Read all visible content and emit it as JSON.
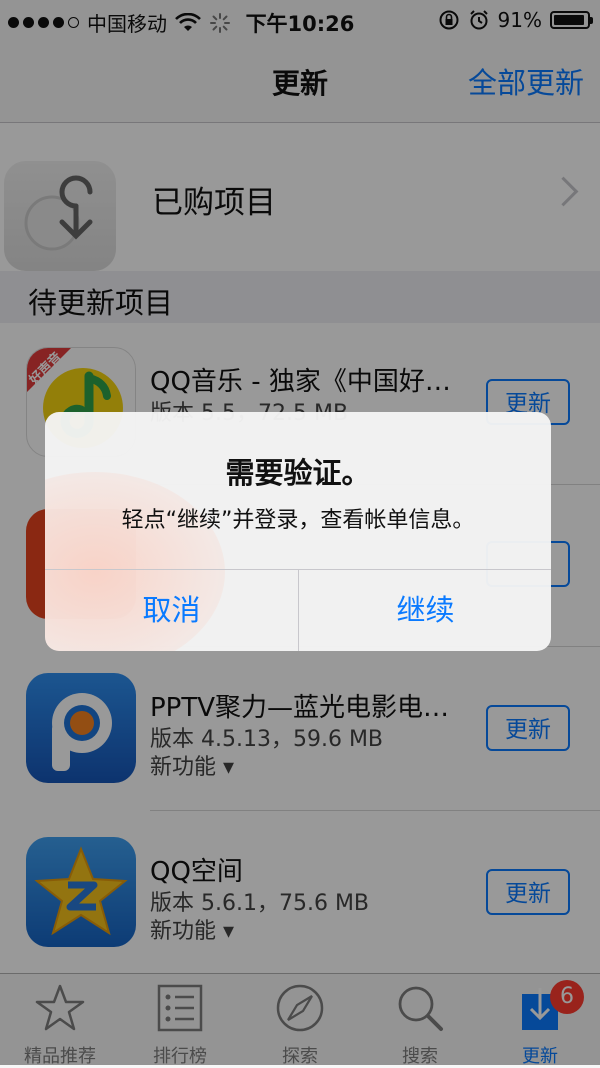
{
  "status_bar": {
    "carrier": "中国移动",
    "time": "下午10:26",
    "battery_percent": "91%",
    "battery_level": 0.91,
    "signal_bars_filled": 4,
    "signal_bars_total": 5
  },
  "nav": {
    "title": "更新",
    "action_label": "全部更新"
  },
  "purchased": {
    "label": "已购项目"
  },
  "section": {
    "label": "待更新项目"
  },
  "apps": [
    {
      "name": "QQ音乐 - 独家《中国好…",
      "version": "版本 5.5，72.5 MB",
      "features": "",
      "badge_text": "好声音",
      "update_label": "更新"
    },
    {
      "name": "",
      "version": "",
      "features": "",
      "update_label": ""
    },
    {
      "name": "PPTV聚力—蓝光电影电…",
      "version": "版本 4.5.13，59.6 MB",
      "features": "新功能 ▾",
      "update_label": "更新"
    },
    {
      "name": "QQ空间",
      "version": "版本 5.6.1，75.6 MB",
      "features": "新功能 ▾",
      "update_label": "更新"
    }
  ],
  "tabbar": {
    "tabs": [
      {
        "label": "精品推荐",
        "icon": "star-icon"
      },
      {
        "label": "排行榜",
        "icon": "list-icon"
      },
      {
        "label": "探索",
        "icon": "compass-icon"
      },
      {
        "label": "搜索",
        "icon": "search-icon"
      },
      {
        "label": "更新",
        "icon": "download-icon",
        "badge": "6"
      }
    ],
    "active_index": 4
  },
  "alert": {
    "title": "需要验证。",
    "message": "轻点“继续”并登录，查看帐单信息。",
    "cancel_label": "取消",
    "continue_label": "继续"
  },
  "colors": {
    "accent": "#0a7aff",
    "badge": "#ff3b30",
    "qq_music_green": "#f5d40f",
    "pptv_blue": "#1e73d8",
    "qzone_blue": "#1a7fd8",
    "qzone_star": "#f6c21c"
  }
}
